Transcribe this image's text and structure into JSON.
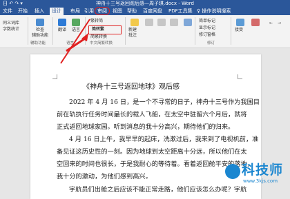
{
  "window": {
    "title": "神舟十三号返回观后感—周子琪.docx - Word"
  },
  "quick_access": {
    "label": "日 ↶ ↷ ▾"
  },
  "tabs": [
    "文件",
    "开始",
    "插入",
    "设计",
    "布局",
    "引用",
    "审阅",
    "视图",
    "帮助",
    "百度网盘",
    "PDF工具集",
    "♀ 操作说明搜索"
  ],
  "ribbon": {
    "proofing": {
      "items": [
        "同义词库",
        "字数统计"
      ],
      "check_label": "检查\n辅助功能",
      "group": "辅助功能"
    },
    "translate": {
      "label": "翻译",
      "group": "语言"
    },
    "language": {
      "label": "语言",
      "group": "语言"
    },
    "comment_new": {
      "label": "新建\n批注"
    },
    "chinese_conv": {
      "items": [
        "繁转简",
        "简转繁",
        "简繁转换"
      ],
      "group": "中文简繁转换"
    },
    "track": {
      "items": [
        "简单标记",
        "显示标记",
        "修订窗格"
      ],
      "group": "修订"
    },
    "accept": {
      "label": "接受"
    },
    "right_labels": [
      "←",
      "→"
    ]
  },
  "document": {
    "title": "《神舟十三号返回地球》观后感",
    "paragraphs": [
      "2022 年 4 月 16 日，是一个不寻常的日子，神舟十三号作为我国目",
      "前在轨执行任务时间最长的载人飞船，在太空中驻留六个月后，就将",
      "正式返回地球家园。听到消息的我十分高兴，期待他们的归来。",
      "4 月 16 日上午，我早早的起床，洗漱过后，我来到了电视机前，准",
      "备见证这历史性的一刻。因为地球到太空距离十分远，所以他们在太",
      "空回来的时间也很长，于是我耐心的等待着。看着返回舱平安的落地，",
      "我十分的激动，为他们感到高兴。",
      "宇航员们出舱之后应该不能正常走路，他们应该怎么办呢？宇航"
    ]
  },
  "watermark": {
    "brand": "科技师",
    "url": "www.3kjs.com"
  }
}
